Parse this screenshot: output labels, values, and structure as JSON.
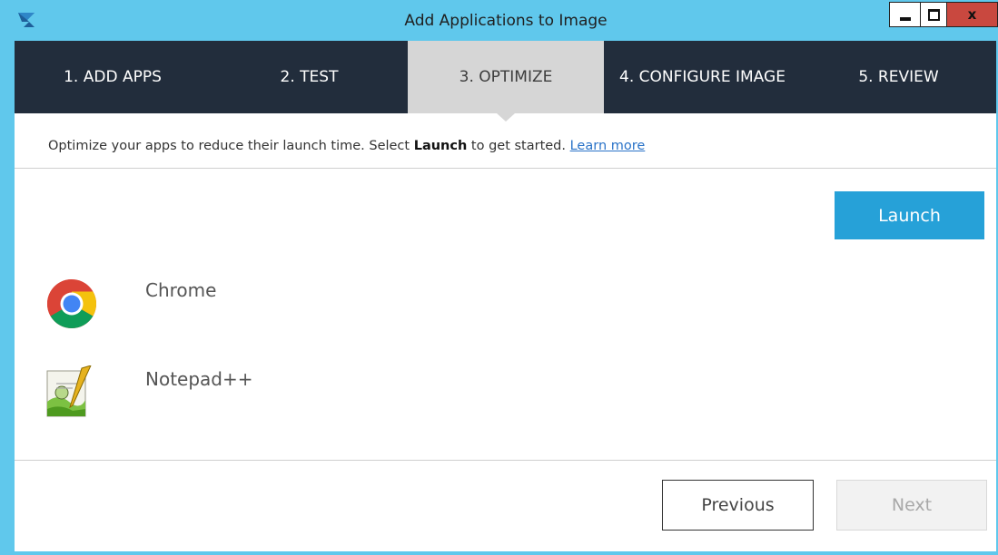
{
  "window": {
    "title": "Add Applications to Image",
    "close_label": "x"
  },
  "steps": [
    {
      "label": "1. ADD APPS",
      "active": false
    },
    {
      "label": "2. TEST",
      "active": false
    },
    {
      "label": "3. OPTIMIZE",
      "active": true
    },
    {
      "label": "4. CONFIGURE IMAGE",
      "active": false
    },
    {
      "label": "5. REVIEW",
      "active": false
    }
  ],
  "info": {
    "text_before": "Optimize your apps to reduce their launch time. Select ",
    "bold": "Launch",
    "text_after": " to get started. ",
    "link": "Learn more"
  },
  "launch_label": "Launch",
  "apps": [
    {
      "name": "Chrome",
      "icon": "chrome-icon"
    },
    {
      "name": "Notepad++",
      "icon": "notepadpp-icon"
    }
  ],
  "footer": {
    "previous_label": "Previous",
    "next_label": "Next",
    "next_disabled": true
  },
  "colors": {
    "frame": "#60c8ec",
    "steps_bg": "#222d3c",
    "active_step_bg": "#d6d6d6",
    "accent": "#26a1d8",
    "link": "#2a73c8",
    "close_button": "#c9483f"
  }
}
